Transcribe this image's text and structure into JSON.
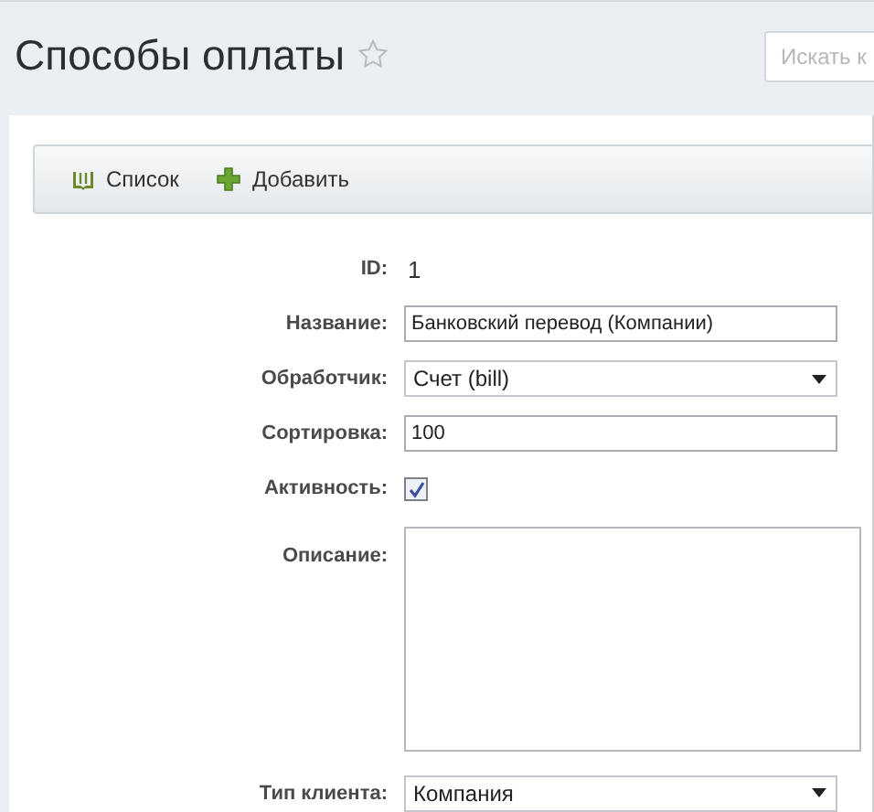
{
  "header": {
    "title": "Способы оплаты",
    "search": {
      "placeholder": "Искать к"
    }
  },
  "toolbar": [
    {
      "label": "Список",
      "kind": "list"
    },
    {
      "label": "Добавить",
      "kind": "add"
    }
  ],
  "fields": [
    {
      "kind": "static",
      "label": "ID:",
      "value": "1"
    },
    {
      "kind": "text",
      "label": "Название:",
      "value": "Банковский перевод (Компании)"
    },
    {
      "kind": "select",
      "label": "Обработчик:",
      "value": "Счет (bill)"
    },
    {
      "kind": "text",
      "label": "Сортировка:",
      "value": "100"
    },
    {
      "kind": "checkbox",
      "label": "Активность:",
      "checked": true
    },
    {
      "kind": "textarea",
      "label": "Описание:"
    },
    {
      "kind": "select",
      "label": "Тип клиента:",
      "value": "Компания"
    }
  ]
}
